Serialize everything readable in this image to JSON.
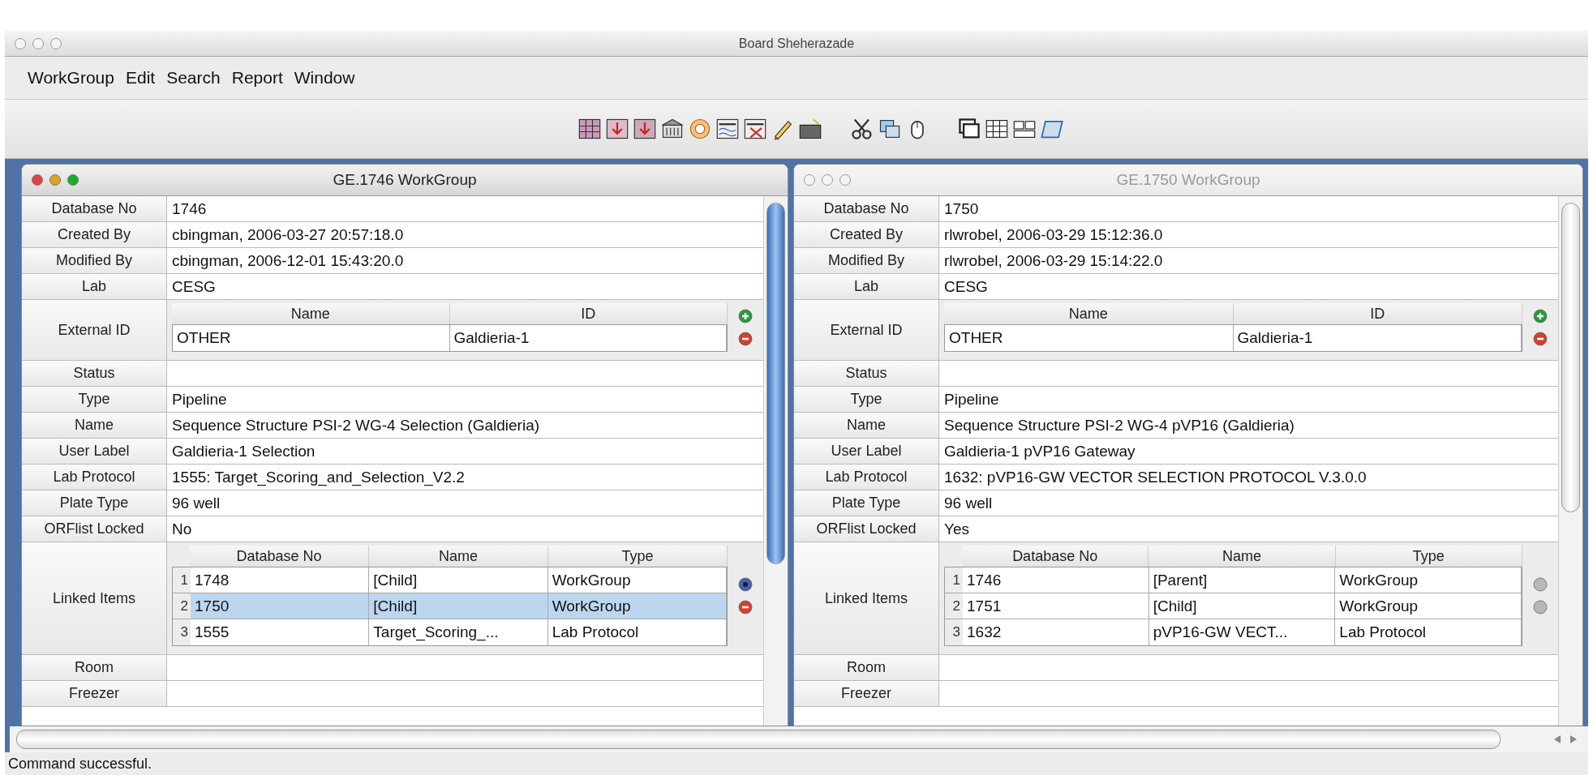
{
  "window": {
    "title": "Board Sheherazade"
  },
  "menu": [
    {
      "label": "WorkGroup"
    },
    {
      "label": "Edit"
    },
    {
      "label": "Search"
    },
    {
      "label": "Report"
    },
    {
      "label": "Window"
    }
  ],
  "panels": [
    {
      "title": "GE.1746 WorkGroup",
      "active": true,
      "fields": [
        {
          "kind": "text",
          "label": "Database No",
          "value": "1746"
        },
        {
          "kind": "text",
          "label": "Created By",
          "value": "cbingman, 2006-03-27 20:57:18.0"
        },
        {
          "kind": "text",
          "label": "Modified By",
          "value": "cbingman, 2006-12-01 15:43:20.0"
        },
        {
          "kind": "text",
          "label": "Lab",
          "value": "CESG"
        },
        {
          "kind": "table",
          "label": "External ID",
          "columns": [
            "Name",
            "ID"
          ],
          "rows": [
            {
              "cells": [
                "OTHER",
                "Galdieria-1"
              ],
              "selected": false
            }
          ],
          "buttons": [
            {
              "kind": "add",
              "disabled": false
            },
            {
              "kind": "remove",
              "disabled": false
            }
          ]
        },
        {
          "kind": "text",
          "label": "Status"
        },
        {
          "kind": "text",
          "label": "Type",
          "value": "Pipeline"
        },
        {
          "kind": "text",
          "label": "Name",
          "value": "Sequence Structure PSI-2 WG-4  Selection (Galdieria)"
        },
        {
          "kind": "text",
          "label": "User Label",
          "value": "Galdieria-1 Selection"
        },
        {
          "kind": "text",
          "label": "Lab Protocol",
          "value": "1555: Target_Scoring_and_Selection_V2.2"
        },
        {
          "kind": "text",
          "label": "Plate Type",
          "value": "96 well"
        },
        {
          "kind": "text",
          "label": "ORFlist Locked",
          "value": "No"
        },
        {
          "kind": "table",
          "label": "Linked Items",
          "columns": [
            "Database No",
            "Name",
            "Type"
          ],
          "rows": [
            {
              "number": "1",
              "cells": [
                "1748",
                "[Child]",
                "WorkGroup"
              ],
              "selected": false
            },
            {
              "number": "2",
              "cells": [
                "1750",
                "[Child]",
                "WorkGroup"
              ],
              "selected": true
            },
            {
              "number": "3",
              "cells": [
                "1555",
                "Target_Scoring_...",
                "Lab Protocol"
              ],
              "selected": false
            }
          ],
          "buttons": [
            {
              "kind": "open",
              "disabled": false
            },
            {
              "kind": "remove",
              "disabled": false
            }
          ]
        },
        {
          "kind": "text",
          "label": "Room"
        },
        {
          "kind": "text",
          "label": "Freezer"
        }
      ]
    },
    {
      "title": "GE.1750 WorkGroup",
      "active": false,
      "fields": [
        {
          "kind": "text",
          "label": "Database No",
          "value": "1750"
        },
        {
          "kind": "text",
          "label": "Created By",
          "value": "rlwrobel, 2006-03-29 15:12:36.0"
        },
        {
          "kind": "text",
          "label": "Modified By",
          "value": "rlwrobel, 2006-03-29 15:14:22.0"
        },
        {
          "kind": "text",
          "label": "Lab",
          "value": "CESG"
        },
        {
          "kind": "table",
          "label": "External ID",
          "columns": [
            "Name",
            "ID"
          ],
          "rows": [
            {
              "cells": [
                "OTHER",
                "Galdieria-1"
              ],
              "selected": false
            }
          ],
          "buttons": [
            {
              "kind": "add",
              "disabled": false
            },
            {
              "kind": "remove",
              "disabled": false
            }
          ]
        },
        {
          "kind": "text",
          "label": "Status"
        },
        {
          "kind": "text",
          "label": "Type",
          "value": "Pipeline"
        },
        {
          "kind": "text",
          "label": "Name",
          "value": "Sequence Structure PSI-2 WG-4  pVP16 (Galdieria)"
        },
        {
          "kind": "text",
          "label": "User Label",
          "value": "Galdieria-1 pVP16 Gateway"
        },
        {
          "kind": "text",
          "label": "Lab Protocol",
          "value": "1632: pVP16-GW VECTOR SELECTION PROTOCOL V.3.0.0"
        },
        {
          "kind": "text",
          "label": "Plate Type",
          "value": "96 well"
        },
        {
          "kind": "text",
          "label": "ORFlist Locked",
          "value": "Yes"
        },
        {
          "kind": "table",
          "label": "Linked Items",
          "columns": [
            "Database No",
            "Name",
            "Type"
          ],
          "rows": [
            {
              "number": "1",
              "cells": [
                "1746",
                "[Parent]",
                "WorkGroup"
              ],
              "selected": false
            },
            {
              "number": "2",
              "cells": [
                "1751",
                "[Child]",
                "WorkGroup"
              ],
              "selected": false
            },
            {
              "number": "3",
              "cells": [
                "1632",
                "pVP16-GW VECT...",
                "Lab Protocol"
              ],
              "selected": false
            }
          ],
          "buttons": [
            {
              "kind": "add",
              "disabled": true
            },
            {
              "kind": "remove",
              "disabled": true
            }
          ]
        },
        {
          "kind": "text",
          "label": "Room"
        },
        {
          "kind": "text",
          "label": "Freezer"
        }
      ]
    }
  ],
  "status_bar": "Command successful."
}
